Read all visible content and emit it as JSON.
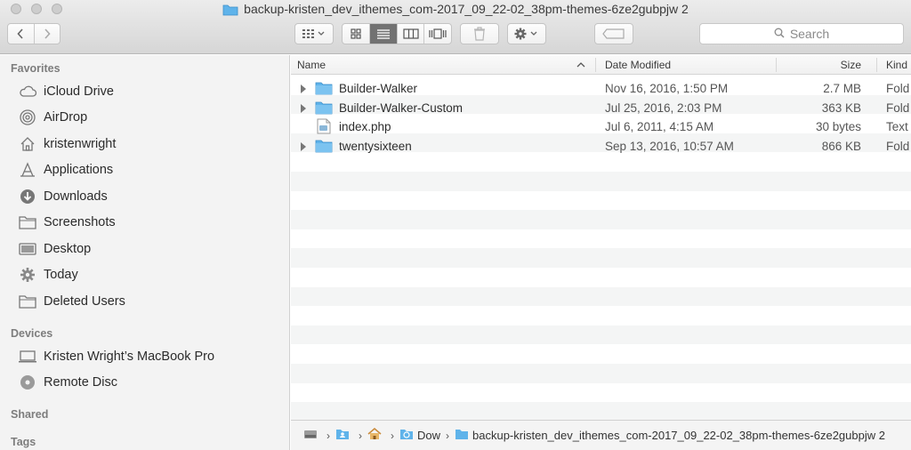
{
  "window": {
    "title": "backup-kristen_dev_ithemes_com-2017_09_22-02_38pm-themes-6ze2gubpjw 2"
  },
  "toolbar": {
    "search_placeholder": "Search"
  },
  "sidebar": {
    "sections": [
      {
        "label": "Favorites"
      },
      {
        "label": "Devices"
      },
      {
        "label": "Shared"
      },
      {
        "label": "Tags"
      }
    ],
    "favorites": [
      {
        "label": "iCloud Drive",
        "icon": "cloud-icon"
      },
      {
        "label": "AirDrop",
        "icon": "airdrop-icon"
      },
      {
        "label": "kristenwright",
        "icon": "home-icon"
      },
      {
        "label": "Applications",
        "icon": "applications-icon"
      },
      {
        "label": "Downloads",
        "icon": "downloads-icon"
      },
      {
        "label": "Screenshots",
        "icon": "folder-icon"
      },
      {
        "label": "Desktop",
        "icon": "desktop-icon"
      },
      {
        "label": "Today",
        "icon": "gear-icon"
      },
      {
        "label": "Deleted Users",
        "icon": "folder-icon"
      }
    ],
    "devices": [
      {
        "label": "Kristen Wright’s MacBook Pro",
        "icon": "laptop-icon"
      },
      {
        "label": "Remote Disc",
        "icon": "disc-icon"
      }
    ]
  },
  "columns": {
    "name": "Name",
    "date": "Date Modified",
    "size": "Size",
    "kind": "Kind"
  },
  "files": [
    {
      "name": "Builder-Walker",
      "date": "Nov 16, 2016, 1:50 PM",
      "size": "2.7 MB",
      "kind": "Fold",
      "type": "folder"
    },
    {
      "name": "Builder-Walker-Custom",
      "date": "Jul 25, 2016, 2:03 PM",
      "size": "363 KB",
      "kind": "Fold",
      "type": "folder"
    },
    {
      "name": "index.php",
      "date": "Jul 6, 2011, 4:15 AM",
      "size": "30 bytes",
      "kind": "Text",
      "type": "file"
    },
    {
      "name": "twentysixteen",
      "date": "Sep 13, 2016, 10:57 AM",
      "size": "866 KB",
      "kind": "Fold",
      "type": "folder"
    }
  ],
  "pathbar": {
    "downloads_short": "Dow",
    "current_folder": "backup-kristen_dev_ithemes_com-2017_09_22-02_38pm-themes-6ze2gubpjw 2"
  },
  "colors": {
    "folder_blue": "#5fb3ea",
    "active_view": "#727272",
    "stripe": "#f4f5f5"
  }
}
